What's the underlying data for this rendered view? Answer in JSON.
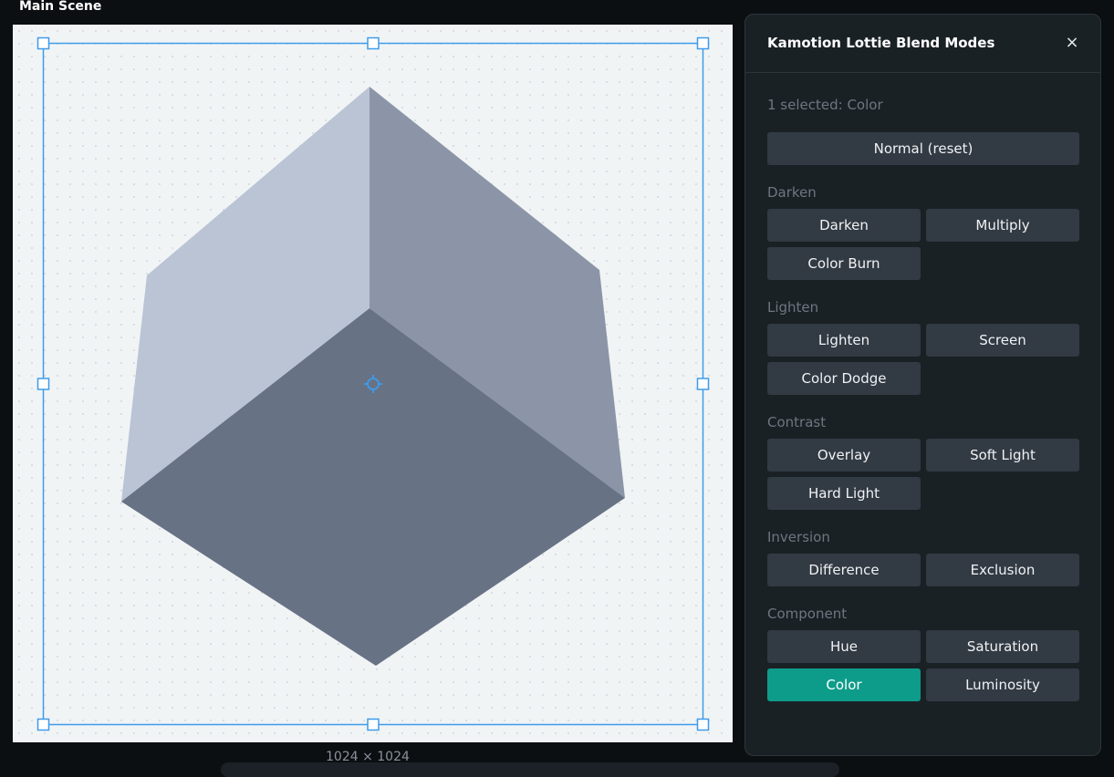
{
  "scene": {
    "title": "Main Scene",
    "dimensions": "1024 × 1024"
  },
  "colors": {
    "selection": "#3f9bea",
    "cube_left_face": "#bac4d5",
    "cube_right_face": "#8c95a7",
    "cube_bottom_face": "#687285",
    "active_button": "#0e9c8a"
  },
  "panel": {
    "title": "Kamotion Lottie Blend Modes",
    "close_icon": "×",
    "status": "1 selected: Color",
    "reset_label": "Normal (reset)",
    "groups": {
      "darken": {
        "label": "Darken",
        "buttons": [
          "Darken",
          "Multiply",
          "Color Burn"
        ]
      },
      "lighten": {
        "label": "Lighten",
        "buttons": [
          "Lighten",
          "Screen",
          "Color Dodge"
        ]
      },
      "contrast": {
        "label": "Contrast",
        "buttons": [
          "Overlay",
          "Soft Light",
          "Hard Light"
        ]
      },
      "inversion": {
        "label": "Inversion",
        "buttons": [
          "Difference",
          "Exclusion"
        ]
      },
      "component": {
        "label": "Component",
        "buttons": [
          "Hue",
          "Saturation",
          "Color",
          "Luminosity"
        ]
      }
    },
    "selected": "Color"
  }
}
